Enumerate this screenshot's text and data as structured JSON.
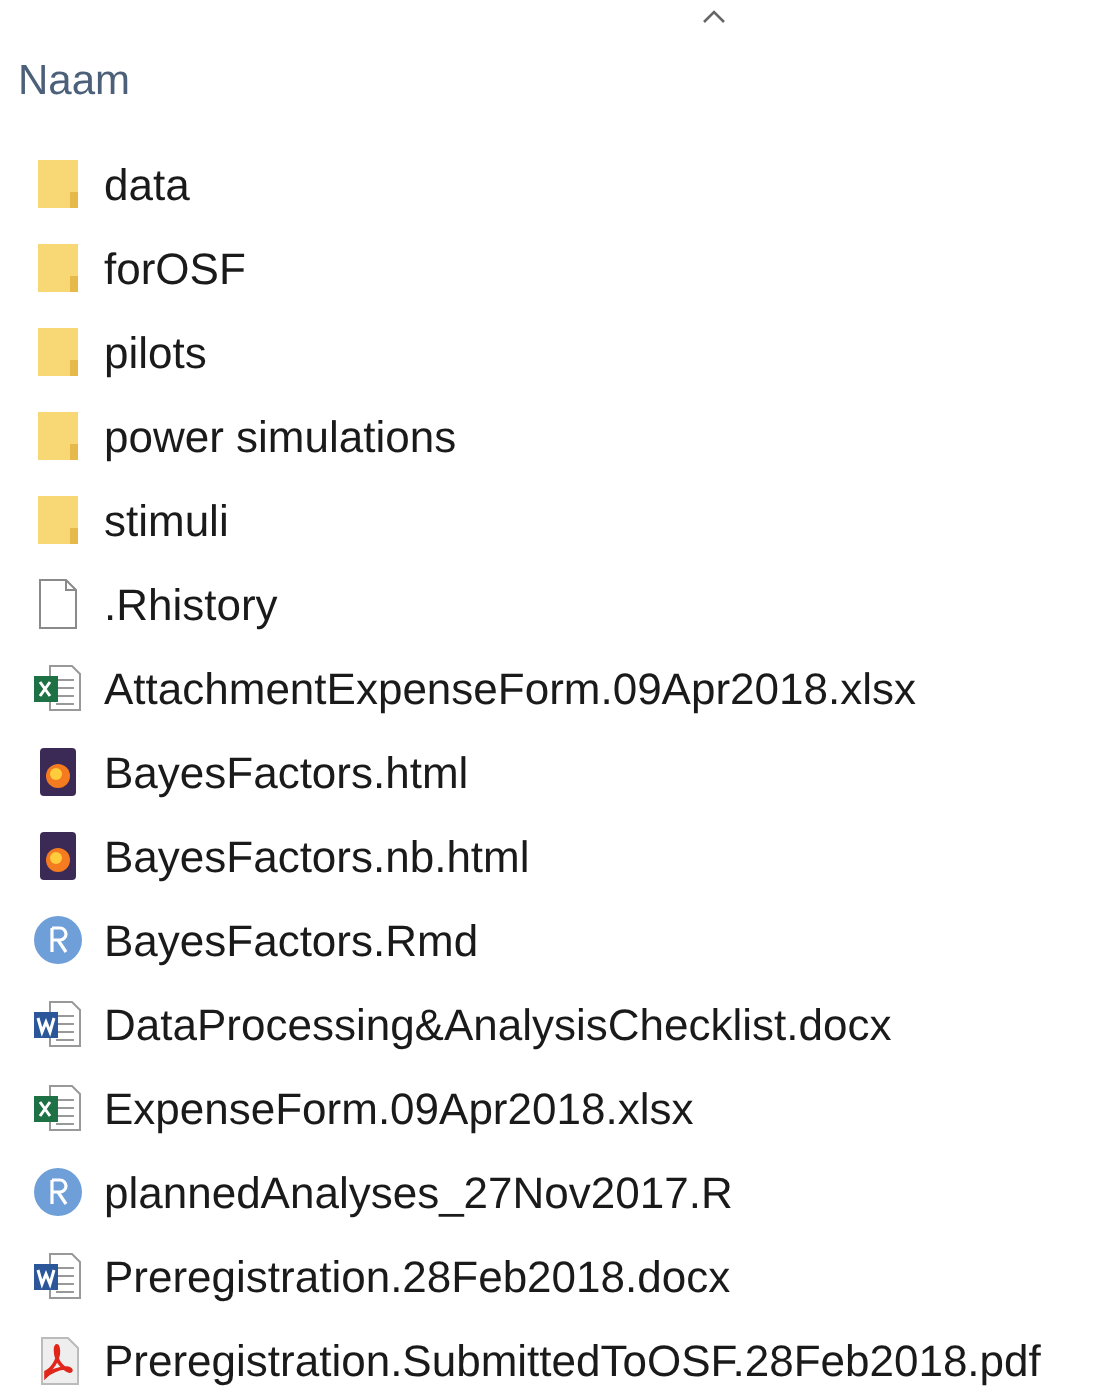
{
  "column_header": {
    "label": "Naam",
    "sorted_ascending": true
  },
  "files": [
    {
      "name": "data",
      "kind": "folder"
    },
    {
      "name": "forOSF",
      "kind": "folder"
    },
    {
      "name": "pilots",
      "kind": "folder"
    },
    {
      "name": "power simulations",
      "kind": "folder"
    },
    {
      "name": "stimuli",
      "kind": "folder"
    },
    {
      "name": ".Rhistory",
      "kind": "file"
    },
    {
      "name": "AttachmentExpenseForm.09Apr2018.xlsx",
      "kind": "excel"
    },
    {
      "name": "BayesFactors.html",
      "kind": "browser"
    },
    {
      "name": "BayesFactors.nb.html",
      "kind": "browser"
    },
    {
      "name": "BayesFactors.Rmd",
      "kind": "r"
    },
    {
      "name": "DataProcessing&AnalysisChecklist.docx",
      "kind": "word"
    },
    {
      "name": "ExpenseForm.09Apr2018.xlsx",
      "kind": "excel"
    },
    {
      "name": "plannedAnalyses_27Nov2017.R",
      "kind": "r"
    },
    {
      "name": "Preregistration.28Feb2018.docx",
      "kind": "word"
    },
    {
      "name": "Preregistration.SubmittedToOSF.28Feb2018.pdf",
      "kind": "pdf"
    }
  ]
}
